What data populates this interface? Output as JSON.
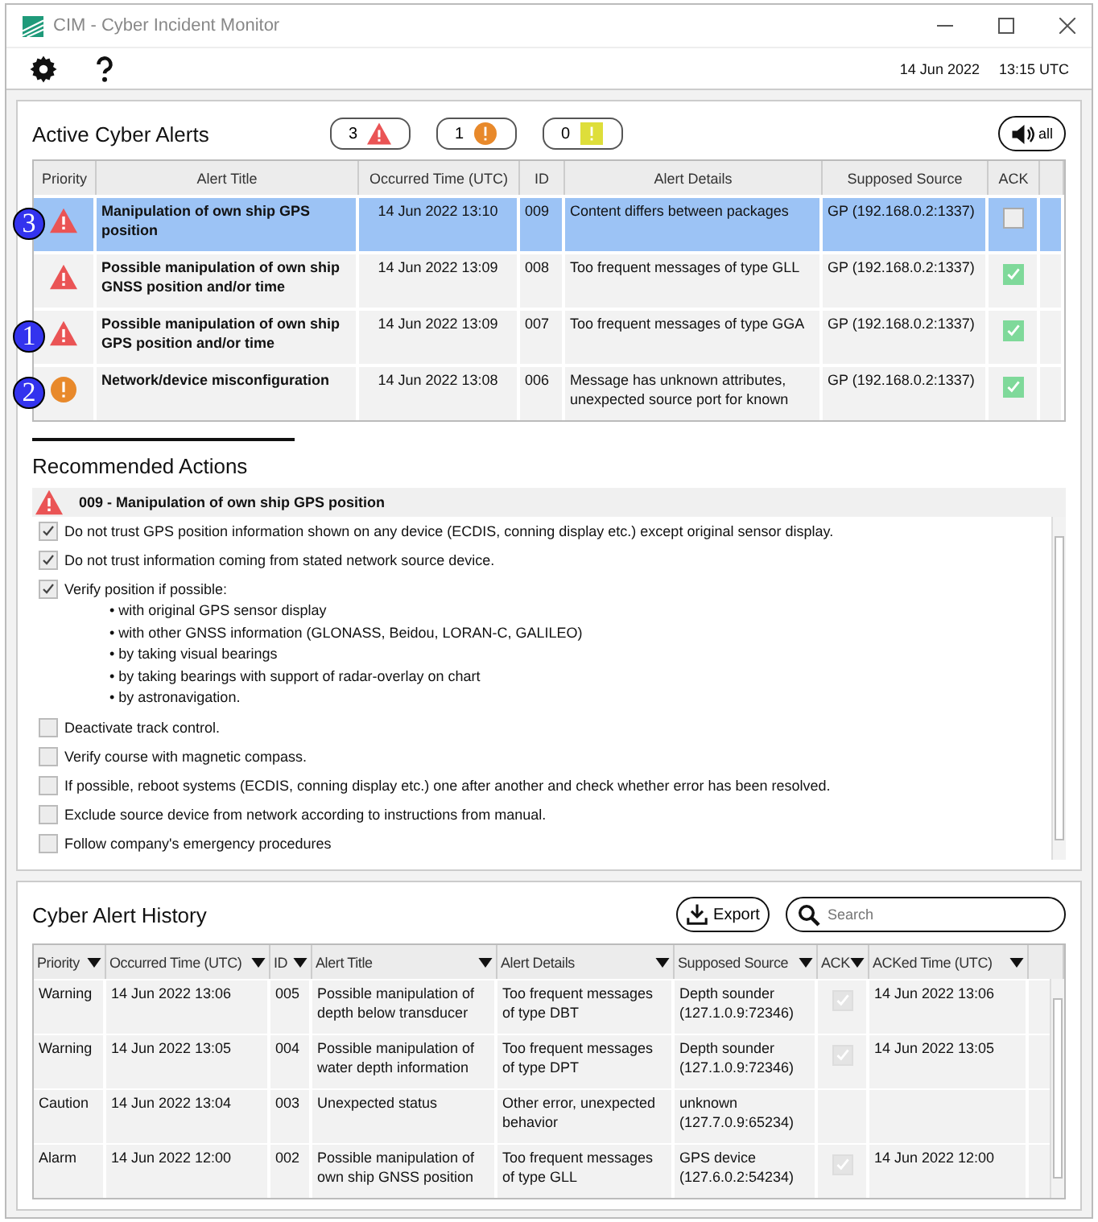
{
  "window": {
    "title": "CIM - Cyber Incident Monitor"
  },
  "toolbar": {
    "date": "14 Jun 2022",
    "time": "13:15 UTC"
  },
  "active_alerts": {
    "title": "Active Cyber Alerts",
    "counters": [
      {
        "kind": "alarm",
        "count": "3"
      },
      {
        "kind": "warning",
        "count": "1"
      },
      {
        "kind": "caution",
        "count": "0"
      }
    ],
    "mute_button": "all",
    "columns": [
      "Priority",
      "Alert Title",
      "Occurred Time (UTC)",
      "ID",
      "Alert Details",
      "Supposed Source",
      "ACK"
    ],
    "rows": [
      {
        "marker": "3",
        "kind": "alarm",
        "title": "Manipulation of own ship GPS position",
        "time": "14 Jun 2022 13:10",
        "id": "009",
        "details": "Content differs between packages",
        "source": "GP (192.168.0.2:1337)",
        "ack": false,
        "selected": true
      },
      {
        "kind": "alarm",
        "title": "Possible manipulation of own ship GNSS position and/or time",
        "time": "14 Jun 2022 13:09",
        "id": "008",
        "details": "Too frequent messages of type GLL",
        "source": "GP (192.168.0.2:1337)",
        "ack": true,
        "selected": false
      },
      {
        "marker": "1",
        "kind": "alarm",
        "title": "Possible manipulation of own ship GPS position and/or time",
        "time": "14 Jun 2022 13:09",
        "id": "007",
        "details": "Too frequent messages of type GGA",
        "source": "GP (192.168.0.2:1337)",
        "ack": true,
        "selected": false
      },
      {
        "marker": "2",
        "kind": "warning",
        "title": "Network/device misconfiguration",
        "time": "14 Jun 2022 13:08",
        "id": "006",
        "details": "Message has unknown attributes, unexpected source port for known",
        "source": "GP (192.168.0.2:1337)",
        "ack": true,
        "selected": false
      }
    ]
  },
  "recommended_actions": {
    "title": "Recommended Actions",
    "alert": {
      "kind": "alarm",
      "title": "009 - Manipulation of own ship GPS position"
    },
    "actions": [
      {
        "text": "Do not trust GPS position information shown on any device (ECDIS, conning display etc.) except original sensor display.",
        "checked": true
      },
      {
        "text": "Do not trust information coming from stated network source device.",
        "checked": true
      },
      {
        "text": "Verify position if possible:",
        "checked": true,
        "subitems": [
          "• with original GPS sensor display",
          "• with other GNSS information (GLONASS, Beidou, LORAN-C, GALILEO)",
          "• by taking visual bearings",
          "• by taking bearings with support of radar-overlay on chart",
          "• by astronavigation."
        ]
      },
      {
        "text": "Deactivate track control.",
        "checked": false
      },
      {
        "text": "Verify course with magnetic compass.",
        "checked": false
      },
      {
        "text": "If possible, reboot systems (ECDIS, conning display etc.) one after another and check whether error has been resolved.",
        "checked": false
      },
      {
        "text": "Exclude source device from network according to instructions from manual.",
        "checked": false
      },
      {
        "text": "Follow company's emergency procedures",
        "checked": false
      }
    ]
  },
  "history": {
    "title": "Cyber Alert History",
    "export_button": "Export",
    "search": {
      "placeholder": "Search"
    },
    "columns": [
      "Priority",
      "Occurred Time (UTC)",
      "ID",
      "Alert Title",
      "Alert Details",
      "Supposed Source",
      "ACK",
      "ACKed Time (UTC)"
    ],
    "rows": [
      {
        "priority": "Warning",
        "time": "14 Jun 2022 13:06",
        "id": "005",
        "title": "Possible manipulation of depth below transducer",
        "details": "Too frequent messages of type DBT",
        "source": "Depth sounder (127.1.0.9:72346)",
        "ack": true,
        "acked_time": "14 Jun 2022 13:06"
      },
      {
        "priority": "Warning",
        "time": "14 Jun 2022 13:05",
        "id": "004",
        "title": "Possible manipulation of water depth information",
        "details": "Too frequent messages of type DPT",
        "source": "Depth sounder (127.1.0.9:72346)",
        "ack": true,
        "acked_time": "14 Jun 2022 13:05"
      },
      {
        "priority": "Caution",
        "time": "14 Jun 2022 13:04",
        "id": "003",
        "title": "Unexpected status",
        "details": "Other error, unexpected behavior",
        "source": "unknown (127.7.0.9:65234)",
        "ack": false
      },
      {
        "priority": "Alarm",
        "time": "14 Jun 2022 12:00",
        "id": "002",
        "title": "Possible manipulation of own ship GNSS position",
        "details": "Too frequent messages of type GLL",
        "source": "GPS device (127.6.0.2:54234)",
        "ack": true,
        "acked_time": "14 Jun 2022 12:00"
      }
    ]
  }
}
